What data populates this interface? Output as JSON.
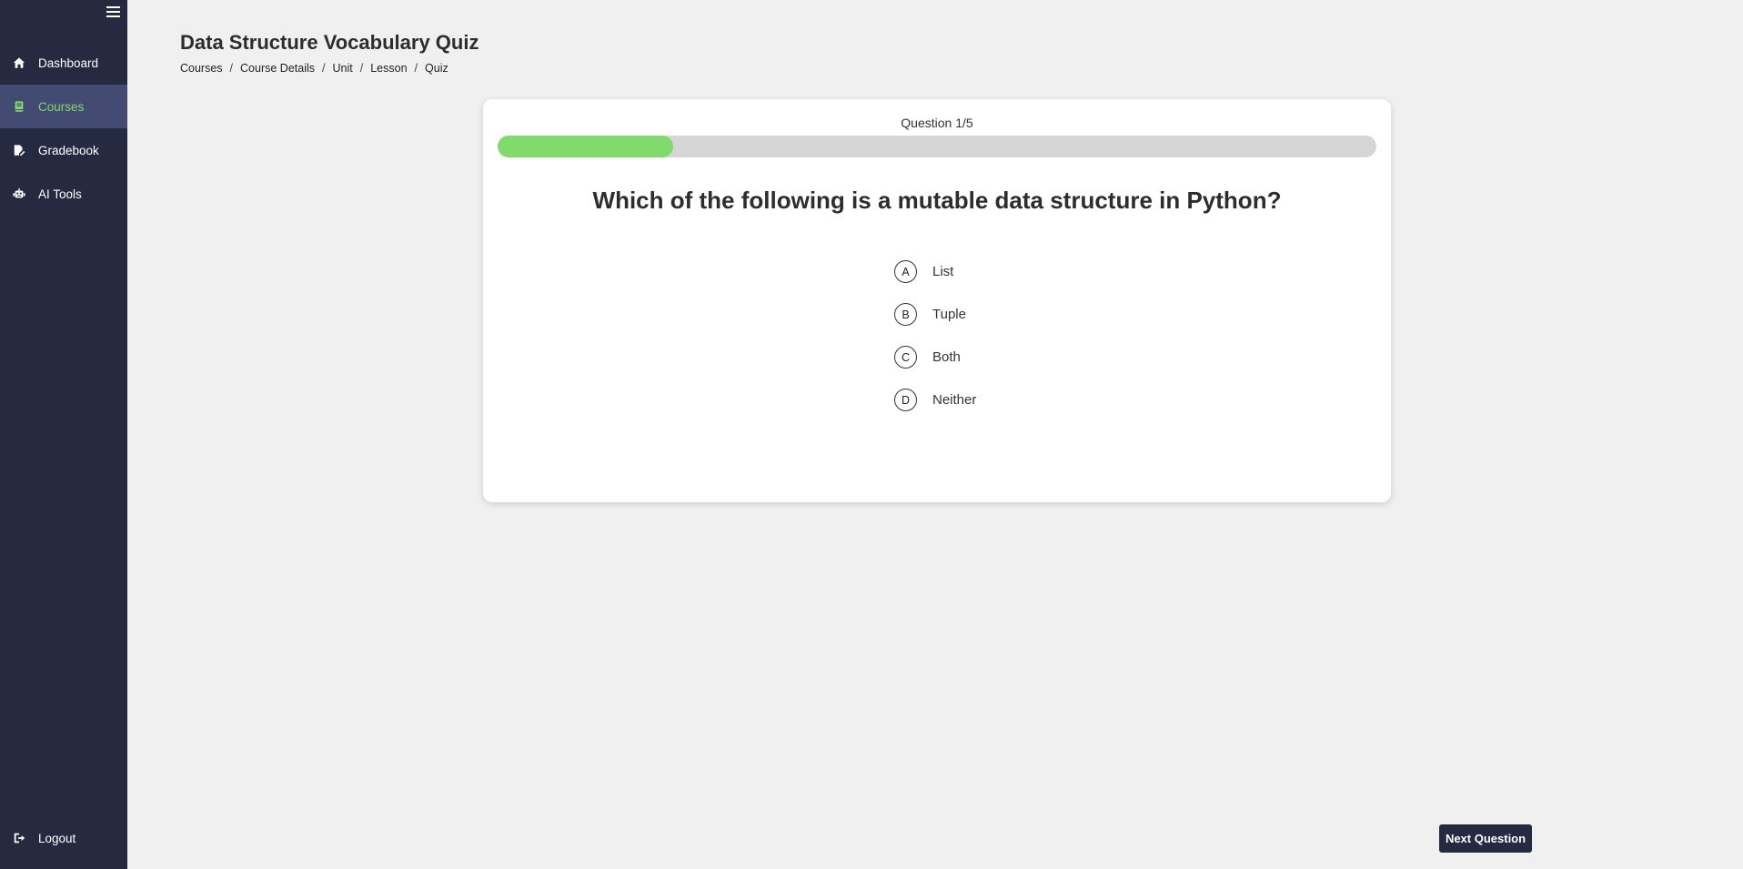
{
  "sidebar": {
    "menu_icon": "hamburger-icon",
    "items": [
      {
        "label": "Dashboard",
        "icon": "home-icon",
        "active": false
      },
      {
        "label": "Courses",
        "icon": "book-icon",
        "active": true
      },
      {
        "label": "Gradebook",
        "icon": "gradebook-edit-icon",
        "active": false
      },
      {
        "label": "AI Tools",
        "icon": "robot-icon",
        "active": false
      }
    ],
    "logout_label": "Logout",
    "logout_icon": "sign-out-icon"
  },
  "header": {
    "title": "Data Structure Vocabulary Quiz",
    "breadcrumb": [
      "Courses",
      "Course Details",
      "Unit",
      "Lesson",
      "Quiz"
    ]
  },
  "quiz": {
    "counter": "Question 1/5",
    "progress_fraction": 0.2,
    "question": "Which of the following is a mutable data structure in Python?",
    "options": [
      {
        "letter": "A",
        "label": "List"
      },
      {
        "letter": "B",
        "label": "Tuple"
      },
      {
        "letter": "C",
        "label": "Both"
      },
      {
        "letter": "D",
        "label": "Neither"
      }
    ]
  },
  "actions": {
    "next_label": "Next Question"
  },
  "colors": {
    "sidebar_bg": "#252a41",
    "active_item_bg": "#434b72",
    "accent_green": "#7fdc6a",
    "page_bg": "#f0f0f0"
  }
}
